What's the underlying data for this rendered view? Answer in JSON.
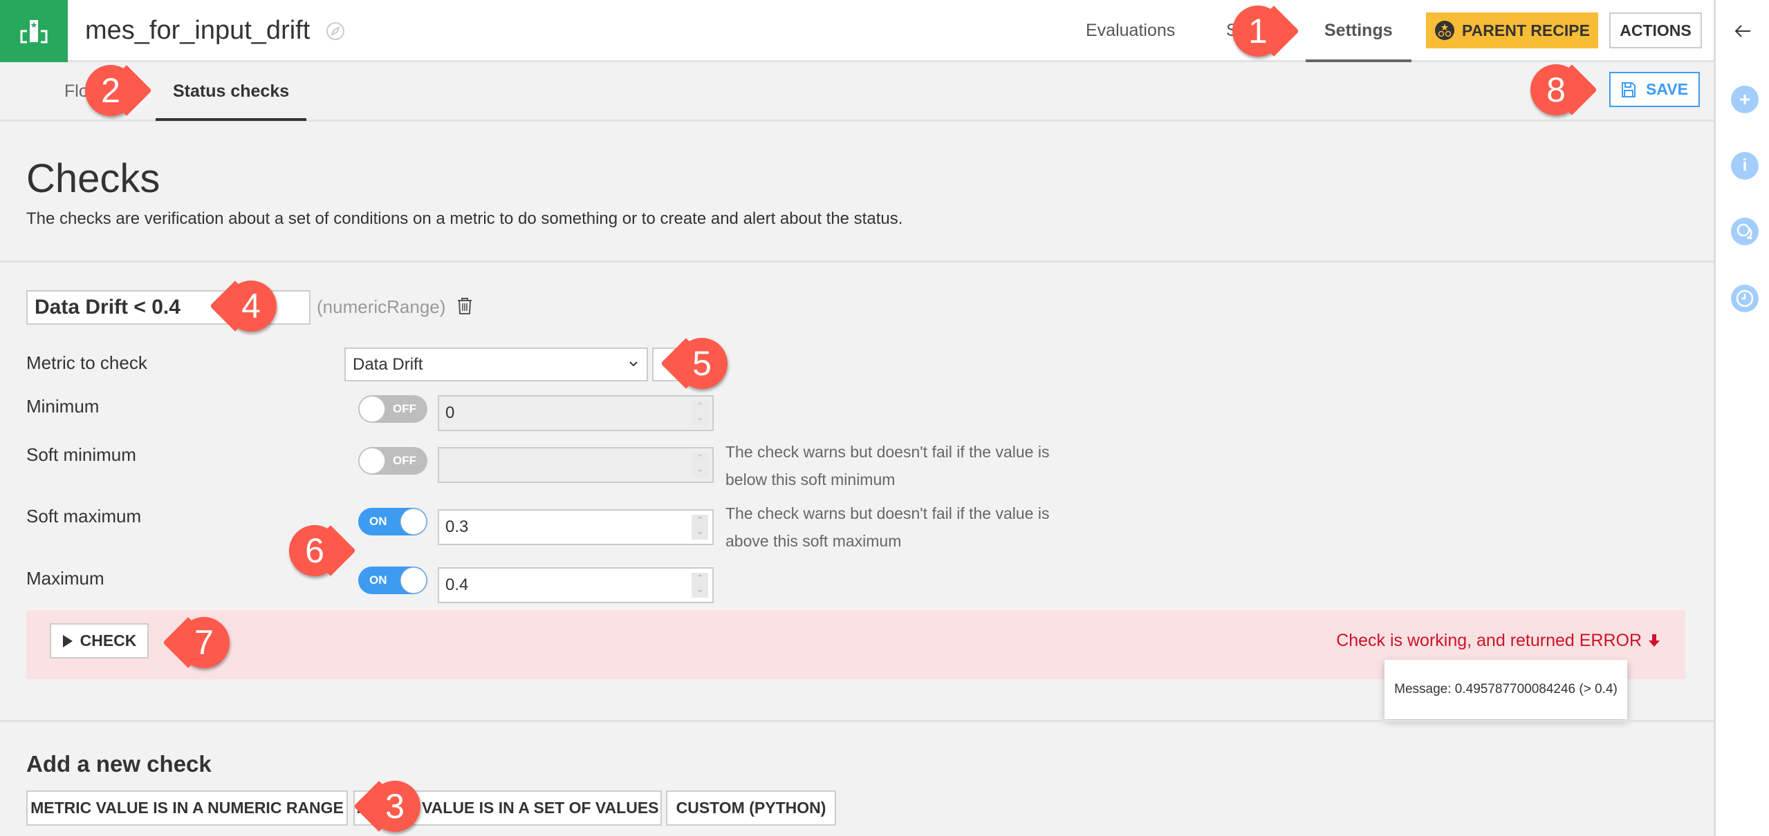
{
  "header": {
    "title": "mes_for_input_drift",
    "tabs": [
      {
        "label": "Evaluations",
        "active": false
      },
      {
        "label": "S",
        "active": false
      },
      {
        "label": "Settings",
        "active": true
      }
    ],
    "parent_recipe_label": "PARENT RECIPE",
    "actions_label": "ACTIONS"
  },
  "subheader": {
    "tabs": [
      {
        "label": "Flo",
        "active": false
      },
      {
        "label": "Status checks",
        "active": true
      }
    ],
    "save_label": "SAVE"
  },
  "page": {
    "title": "Checks",
    "description": "The checks are verification about a set of conditions on a metric to do something or to create and alert about the status."
  },
  "check": {
    "name": "Data Drift < 0.4",
    "type": "(numericRange)",
    "rows": {
      "metric": {
        "label": "Metric to check",
        "value": "Data Drift"
      },
      "minimum": {
        "label": "Minimum",
        "toggle": "OFF",
        "value": "0"
      },
      "soft_minimum": {
        "label": "Soft minimum",
        "toggle": "OFF",
        "value": "",
        "help": "The check warns but doesn't fail if the value is below this soft minimum"
      },
      "soft_maximum": {
        "label": "Soft maximum",
        "toggle": "ON",
        "value": "0.3",
        "help": "The check warns but doesn't fail if the value is above this soft maximum"
      },
      "maximum": {
        "label": "Maximum",
        "toggle": "ON",
        "value": "0.4"
      }
    },
    "check_button_label": "CHECK",
    "result_text": "Check is working, and returned ERROR",
    "result_message": "Message: 0.495787700084246 (> 0.4)",
    "error_color": "#ce1228"
  },
  "add_check": {
    "title": "Add a new check",
    "buttons": [
      "METRIC VALUE IS IN A NUMERIC RANGE",
      "METRIC VALUE IS IN A SET OF VALUES",
      "CUSTOM (PYTHON)"
    ]
  },
  "annotations": [
    "1",
    "2",
    "3",
    "4",
    "5",
    "6",
    "7",
    "8"
  ],
  "colors": {
    "brand_green": "#28a85c",
    "accent_blue": "#3d9bf2",
    "parent_recipe_yellow": "#f8bc36",
    "marker_red": "#fe5a4c"
  }
}
